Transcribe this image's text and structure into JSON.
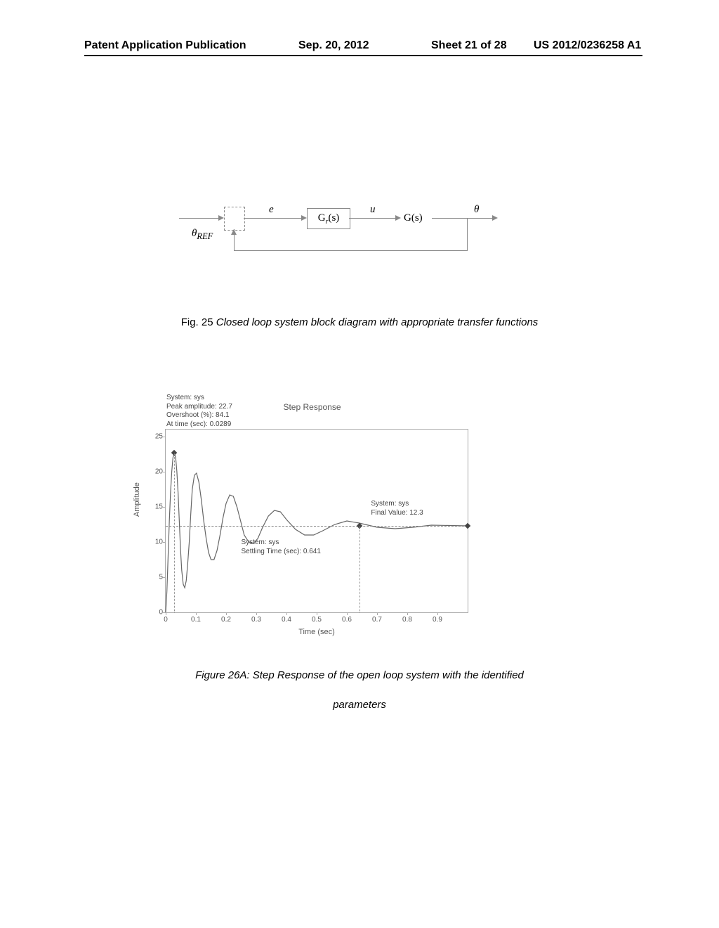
{
  "header": {
    "left": "Patent Application Publication",
    "date": "Sep. 20, 2012",
    "sheet": "Sheet 21 of 28",
    "pubno": "US 2012/0236258 A1"
  },
  "block_diagram": {
    "input": "θ",
    "input_sub": "REF",
    "err": "e",
    "gr": "G",
    "gr_sub": "r",
    "gr_arg": "(s)",
    "u": "u",
    "g": "G(s)",
    "output": "θ"
  },
  "fig25": {
    "prefix": "Fig. 25",
    "caption": " Closed loop system block diagram with appropriate transfer functions"
  },
  "chart_data": {
    "type": "line",
    "title": "Step Response",
    "xlabel": "Time (sec)",
    "ylabel": "Amplitude",
    "xlim": [
      0,
      1.0
    ],
    "ylim": [
      0,
      26
    ],
    "xticks": [
      0,
      0.1,
      0.2,
      0.3,
      0.4,
      0.5,
      0.6,
      0.7,
      0.8,
      0.9
    ],
    "yticks": [
      0,
      5,
      10,
      15,
      20,
      25
    ],
    "annotations": {
      "peak": {
        "label_lines": [
          "System: sys",
          "Peak amplitude: 22.7",
          "Overshoot (%): 84.1",
          "At time (sec): 0.0289"
        ],
        "x": 0.0289,
        "y": 22.7
      },
      "settling": {
        "label_lines": [
          "System: sys",
          "Settling Time (sec): 0.641"
        ],
        "x": 0.641,
        "y": 12.3
      },
      "final": {
        "label_lines": [
          "System: sys",
          "Final Value: 12.3"
        ],
        "x": 1.0,
        "y": 12.3
      }
    },
    "series": [
      {
        "name": "sys",
        "x": [
          0,
          0.004,
          0.008,
          0.012,
          0.016,
          0.02,
          0.024,
          0.0289,
          0.033,
          0.037,
          0.041,
          0.045,
          0.049,
          0.053,
          0.058,
          0.063,
          0.068,
          0.073,
          0.078,
          0.083,
          0.088,
          0.095,
          0.102,
          0.11,
          0.118,
          0.126,
          0.134,
          0.142,
          0.15,
          0.16,
          0.17,
          0.18,
          0.19,
          0.2,
          0.212,
          0.224,
          0.236,
          0.248,
          0.26,
          0.275,
          0.29,
          0.305,
          0.32,
          0.34,
          0.36,
          0.38,
          0.4,
          0.43,
          0.46,
          0.49,
          0.52,
          0.56,
          0.6,
          0.641,
          0.7,
          0.76,
          0.82,
          0.88,
          0.94,
          1.0
        ],
        "y": [
          0,
          3,
          8,
          13,
          17,
          20,
          22,
          22.7,
          22,
          20,
          17,
          13,
          9,
          6,
          4,
          3.5,
          4.5,
          7,
          10,
          14,
          17.5,
          19.5,
          19.8,
          18.5,
          16,
          13,
          10.5,
          8.5,
          7.5,
          7.5,
          8.8,
          11,
          13.5,
          15.5,
          16.7,
          16.5,
          15,
          13,
          11,
          10,
          9.8,
          10.5,
          12,
          13.7,
          14.5,
          14.3,
          13.2,
          11.8,
          11,
          11,
          11.6,
          12.5,
          13,
          12.7,
          12.1,
          11.9,
          12.1,
          12.4,
          12.35,
          12.3
        ]
      }
    ]
  },
  "fig26": {
    "line1": "Figure 26A: Step Response of the open loop system with the identified",
    "line2": "parameters"
  }
}
